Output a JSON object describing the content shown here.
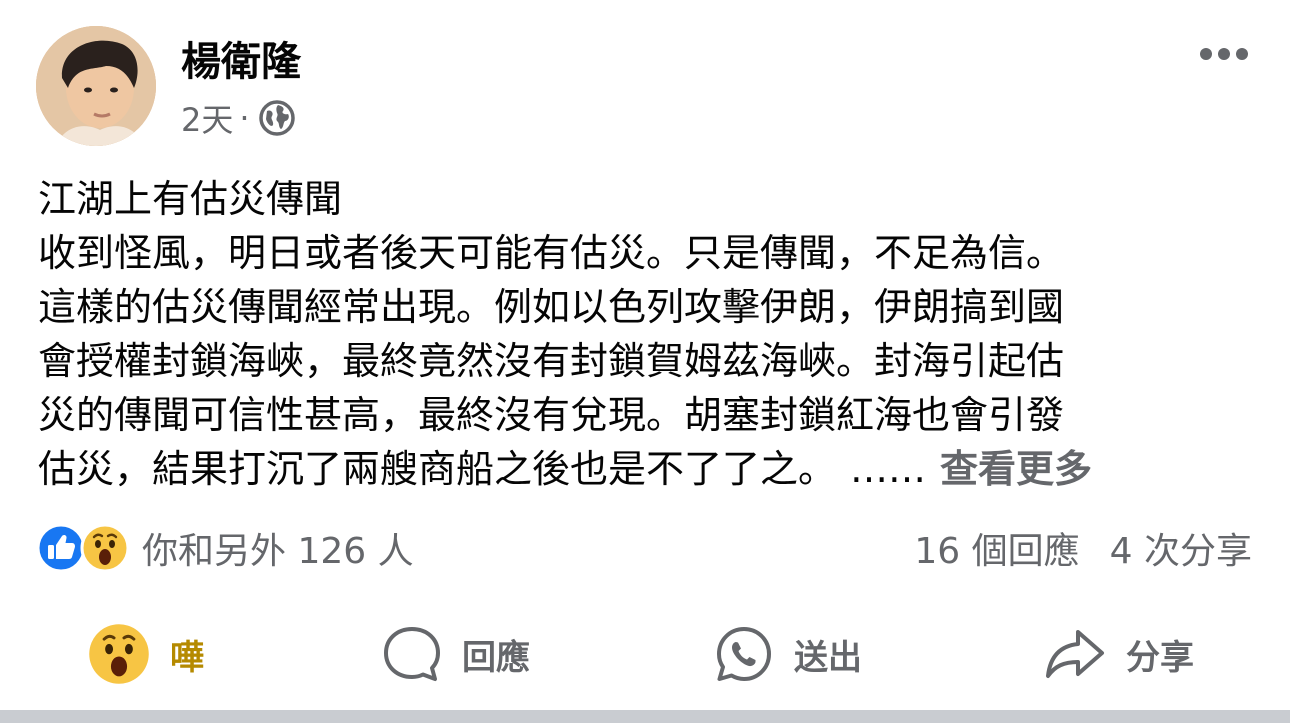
{
  "post": {
    "author": "楊衛隆",
    "time": "2天",
    "separator": "·",
    "audience_icon": "globe-icon",
    "text_lines": [
      "江湖上有估災傳聞",
      "收到怪風，明日或者後天可能有估災。只是傳聞，不足為信。",
      "這樣的估災傳聞經常出現。例如以色列攻擊伊朗，伊朗搞到國",
      "會授權封鎖海峽，最終竟然沒有封鎖賀姆茲海峽。封海引起估",
      "災的傳聞可信性甚高，最終沒有兌現。胡塞封鎖紅海也會引發",
      "估災，結果打沉了兩艘商船之後也是不了了之。"
    ],
    "ellipsis": "……",
    "see_more": "查看更多"
  },
  "reactions": {
    "icons": [
      "like-icon",
      "wow-icon"
    ],
    "summary": "你和另外 126 人"
  },
  "stats": {
    "comments": "16 個回應",
    "shares": "4 次分享"
  },
  "actions": {
    "wow": "嘩",
    "comment": "回應",
    "send": "送出",
    "share": "分享"
  },
  "colors": {
    "secondary_text": "#65676b",
    "like_blue": "#1877f2",
    "wow_yellow": "#f7c544",
    "active_reaction": "#b58a00",
    "divider": "#c9ccd1"
  }
}
